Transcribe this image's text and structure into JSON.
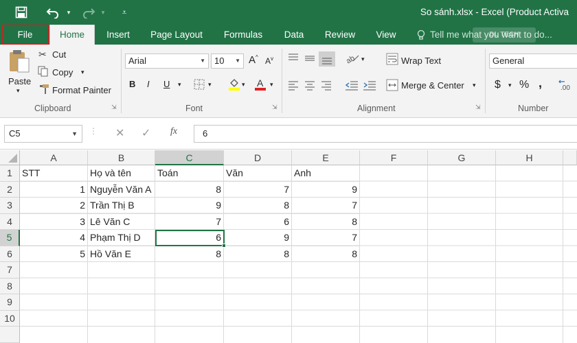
{
  "window": {
    "title": "So sánh.xlsx - Excel (Product Activa"
  },
  "quick_access": {
    "save_icon": "save-icon",
    "undo_icon": "undo-icon",
    "redo_icon": "redo-icon",
    "customize_icon": "customize-icon"
  },
  "tabs": [
    {
      "label": "File"
    },
    {
      "label": "Home"
    },
    {
      "label": "Insert"
    },
    {
      "label": "Page Layout"
    },
    {
      "label": "Formulas"
    },
    {
      "label": "Data"
    },
    {
      "label": "Review"
    },
    {
      "label": "View"
    }
  ],
  "tell_me": {
    "text": "Tell me what you want to do..."
  },
  "watermark": {
    "text": "DL TECH"
  },
  "clipboard": {
    "paste": "Paste",
    "cut": "Cut",
    "copy": "Copy",
    "format_painter": "Format Painter",
    "label": "Clipboard"
  },
  "font": {
    "name": "Arial",
    "size": "10",
    "bold": "B",
    "italic": "I",
    "underline": "U",
    "label": "Font",
    "grow": "A",
    "shrink": "A"
  },
  "alignment": {
    "wrap_text": "Wrap Text",
    "merge_center": "Merge & Center",
    "label": "Alignment"
  },
  "number": {
    "format": "General",
    "label": "Number",
    "currency": "$",
    "percent": "%",
    "comma": ","
  },
  "formula_bar": {
    "name_box": "C5",
    "fx": "fx",
    "value": "6"
  },
  "columns": [
    "A",
    "B",
    "C",
    "D",
    "E",
    "F",
    "G",
    "H"
  ],
  "rows": [
    "1",
    "2",
    "3",
    "4",
    "5",
    "6",
    "7",
    "8",
    "9",
    "10"
  ],
  "colors": {
    "excel_green": "#217346",
    "file_highlight": "#d11f1f"
  },
  "sheet": {
    "row1": [
      "STT",
      "Họ và tên",
      "Toán",
      "Văn",
      "Anh"
    ],
    "row2": [
      "1",
      "Nguyễn Văn A",
      "8",
      "7",
      "9"
    ],
    "row3": [
      "2",
      "Trần Thị B",
      "9",
      "8",
      "7"
    ],
    "row4": [
      "3",
      "Lê Văn C",
      "7",
      "6",
      "8"
    ],
    "row5": [
      "4",
      "Phạm Thị D",
      "6",
      "9",
      "7"
    ],
    "row6": [
      "5",
      "Hồ Văn E",
      "8",
      "8",
      "8"
    ]
  }
}
